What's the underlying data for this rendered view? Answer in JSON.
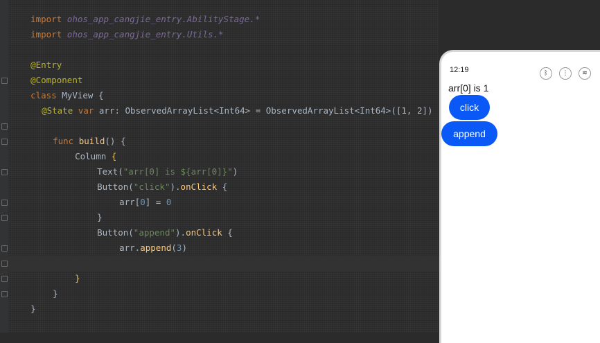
{
  "editor": {
    "lines": {
      "l1": {
        "kw": "import",
        "rest": " ohos_app_cangjie_entry.AbilityStage.*"
      },
      "l2": {
        "kw": "import",
        "rest": " ohos_app_cangjie_entry.Utils.*"
      },
      "l4": {
        "ann": "@Entry"
      },
      "l5": {
        "ann": "@Component"
      },
      "l6": {
        "kw": "class",
        "rest": " MyView {"
      },
      "l7": {
        "ann": "@State",
        "kw": " var",
        "rest": " arr: ObservedArrayList<Int64> = ObservedArrayList<Int64>([1, 2])"
      },
      "l9": {
        "kw": "func",
        "fn": " build",
        "rest": "() {"
      },
      "l10": {
        "rest": "Column ",
        "brace": "{"
      },
      "l11": {
        "rest": "Text(",
        "str": "\"arr[0] is ${arr[0]}\"",
        "tail": ")"
      },
      "l12": {
        "rest": "Button(",
        "str": "\"click\"",
        "tail": ").",
        "fn": "onClick",
        "tail2": " {"
      },
      "l13": {
        "rest": "arr[",
        "num": "0",
        "tail": "] = ",
        "num2": "0"
      },
      "l14": {
        "rest": "}"
      },
      "l15": {
        "rest": "Button(",
        "str": "\"append\"",
        "tail": ").",
        "fn": "onClick",
        "tail2": " {"
      },
      "l16": {
        "rest": "arr.",
        "fn": "append",
        "tail": "(",
        "num": "3",
        "tail2": ")"
      },
      "l17": {
        "rest": "}"
      },
      "l18": {
        "brace": "}"
      },
      "l19": {
        "rest": "}"
      },
      "l20": {
        "rest": "}"
      }
    }
  },
  "device": {
    "status_time": "12:19",
    "status_icons": [
      "bluetooth-icon",
      "signal-icon",
      "wifi-icon"
    ],
    "text": "arr[0] is 1",
    "click_label": "click",
    "append_label": "append",
    "accent": "#0a59f7"
  }
}
